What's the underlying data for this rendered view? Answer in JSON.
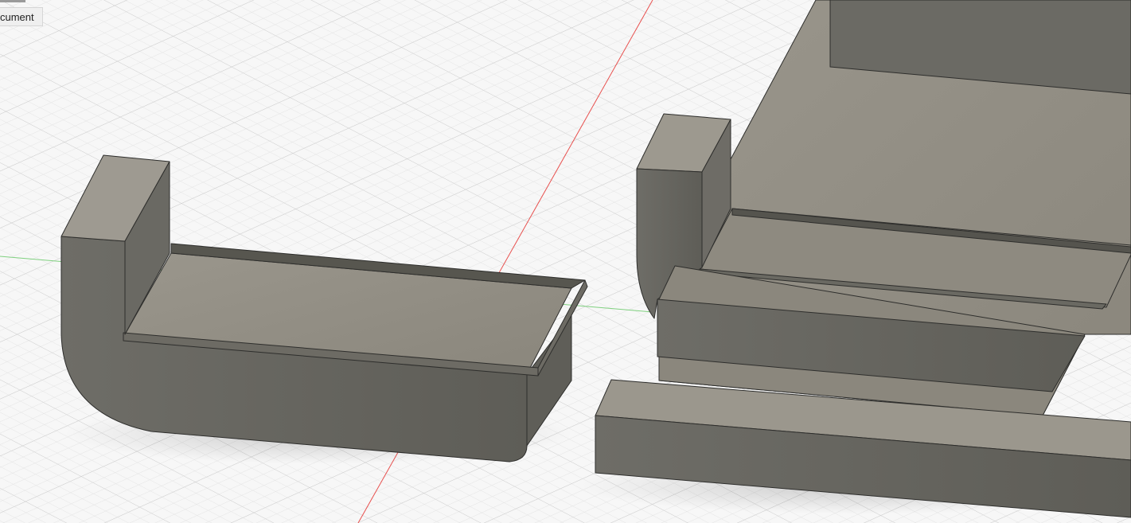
{
  "document_tab": {
    "label": "cument"
  },
  "colors": {
    "background": "#f7f7f7",
    "grid_minor": "#e6e6e6",
    "grid_major": "#cfcfcf",
    "x_axis": "#e8504e",
    "y_axis": "#7fd07f",
    "body_top": "#928d83",
    "body_side": "#686760",
    "body_dark": "#55544f",
    "edge": "#2e2e2c"
  }
}
